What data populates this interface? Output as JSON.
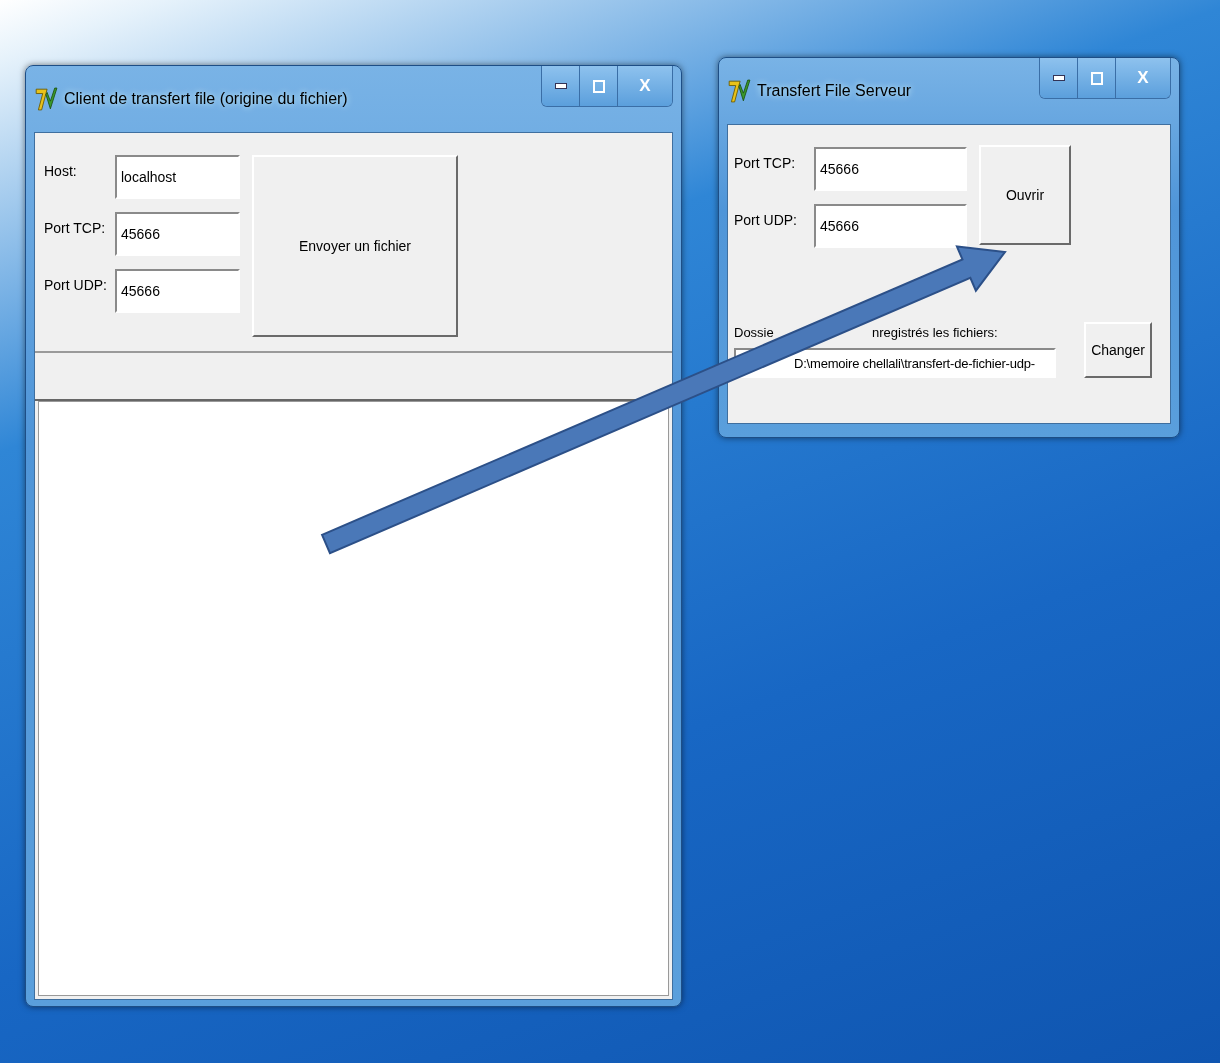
{
  "client_window": {
    "title": "Client de transfert file (origine du fichier)",
    "close_label": "X",
    "fields": [
      {
        "label": "Host:",
        "value": "localhost"
      },
      {
        "label": "Port TCP:",
        "value": "45666"
      },
      {
        "label": "Port UDP:",
        "value": "45666"
      }
    ],
    "send_button": "Envoyer un fichier"
  },
  "server_window": {
    "title": "Transfert File Serveur",
    "close_label": "X",
    "fields": [
      {
        "label": "Port TCP:",
        "value": "45666"
      },
      {
        "label": "Port UDP:",
        "value": "45666"
      }
    ],
    "open_button": "Ouvrir",
    "folder_label_parts": [
      "Dossie",
      "nregistrés les fichiers:"
    ],
    "folder_path": "D:\\memoire chellali\\transfert-de-fichier-udp-",
    "change_button": "Changer"
  }
}
